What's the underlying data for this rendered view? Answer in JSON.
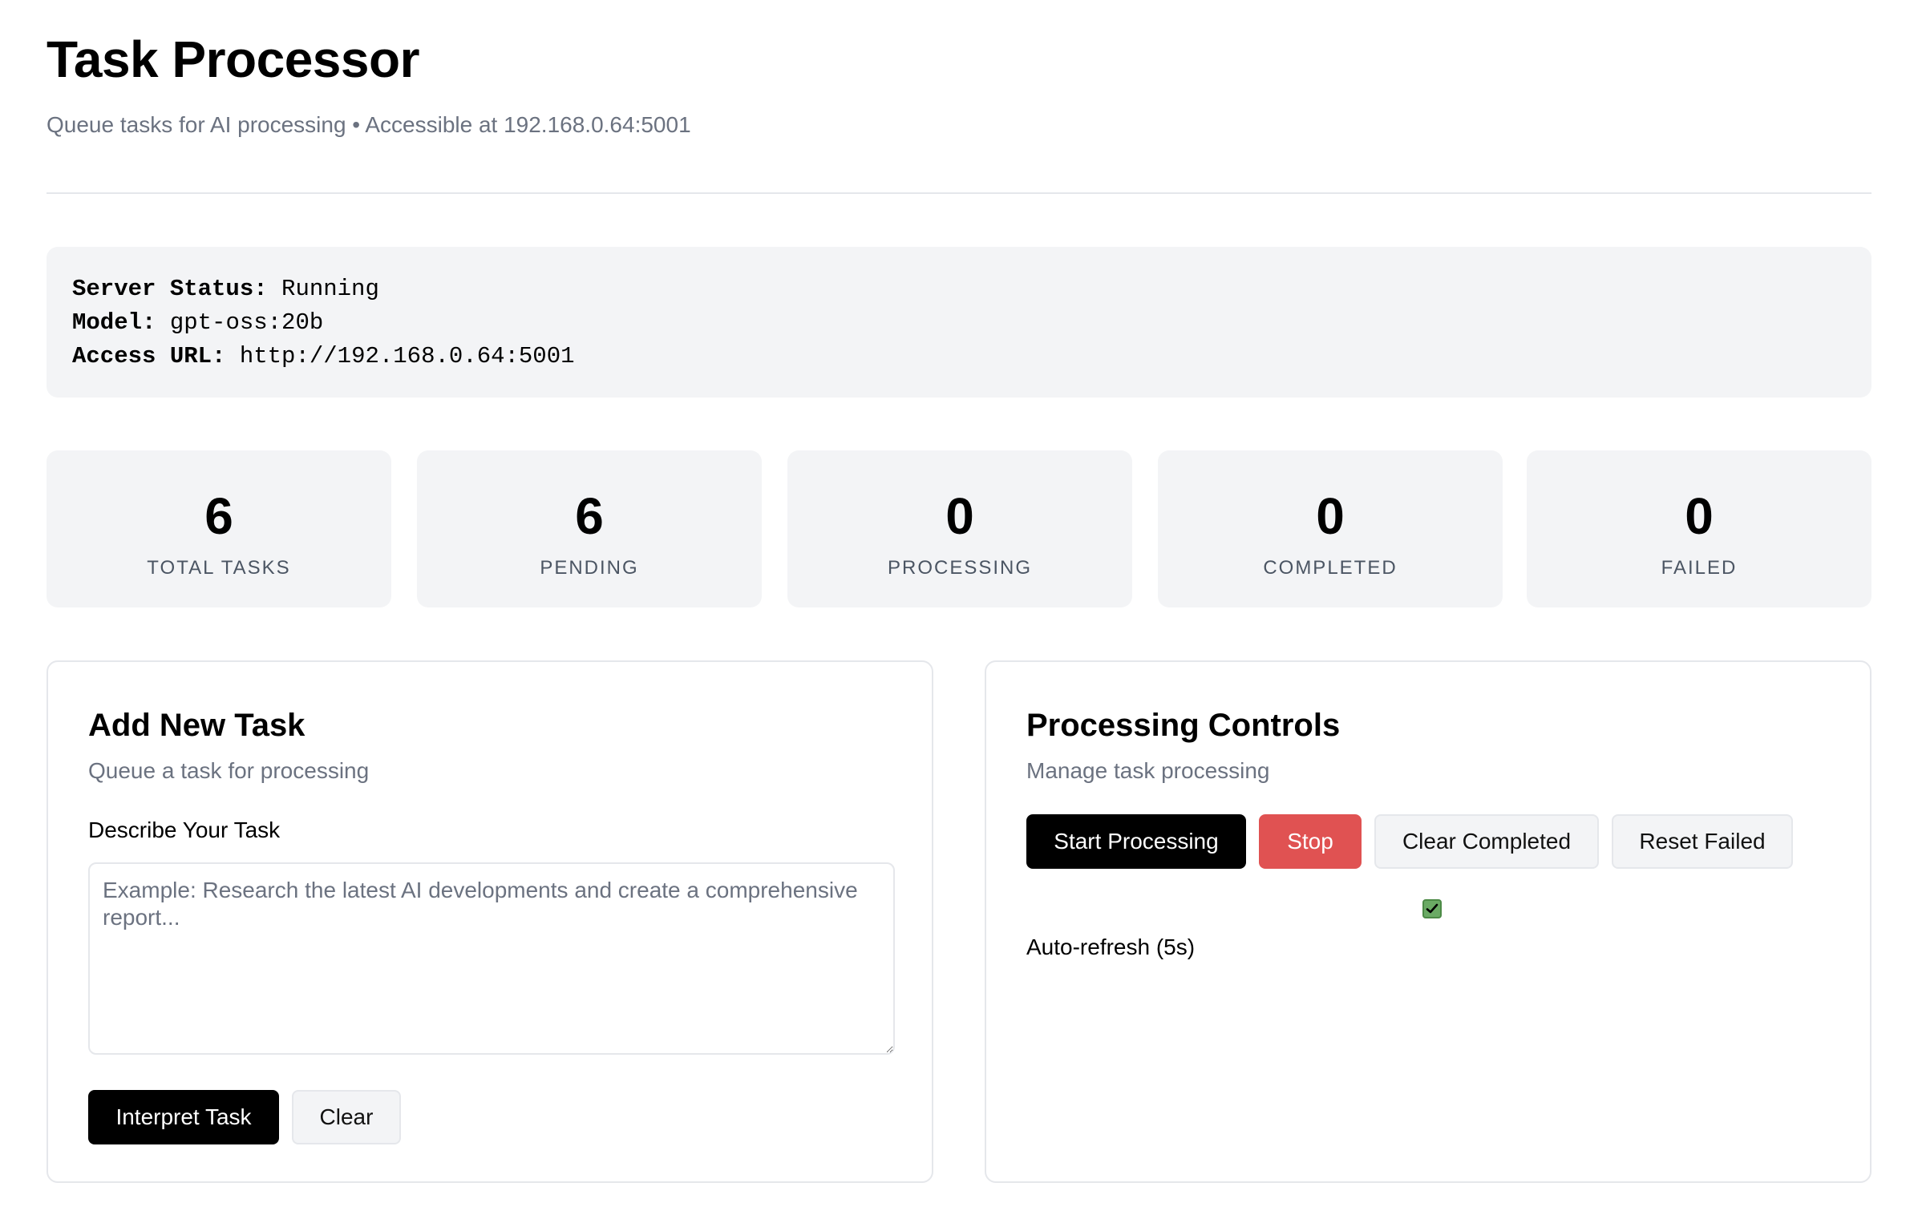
{
  "header": {
    "title": "Task Processor",
    "subtitle": "Queue tasks for AI processing • Accessible at 192.168.0.64:5001"
  },
  "server": {
    "status_key": "Server Status:",
    "status_value": "Running",
    "model_key": "Model:",
    "model_value": "gpt-oss:20b",
    "url_key": "Access URL:",
    "url_value": "http://192.168.0.64:5001"
  },
  "stats": [
    {
      "value": "6",
      "label": "TOTAL TASKS"
    },
    {
      "value": "6",
      "label": "PENDING"
    },
    {
      "value": "0",
      "label": "PROCESSING"
    },
    {
      "value": "0",
      "label": "COMPLETED"
    },
    {
      "value": "0",
      "label": "FAILED"
    }
  ],
  "add_task": {
    "title": "Add New Task",
    "subtitle": "Queue a task for processing",
    "field_label": "Describe Your Task",
    "textarea_value": "",
    "textarea_placeholder": "Example: Research the latest AI developments and create a comprehensive report...",
    "interpret_label": "Interpret Task",
    "clear_label": "Clear"
  },
  "controls": {
    "title": "Processing Controls",
    "subtitle": "Manage task processing",
    "start_label": "Start Processing",
    "stop_label": "Stop",
    "clear_completed_label": "Clear Completed",
    "reset_failed_label": "Reset Failed",
    "auto_refresh_label": "Auto-refresh (5s)",
    "auto_refresh_checked": true
  },
  "colors": {
    "primary": "#000000",
    "danger": "#e05252",
    "panel_bg": "#f3f4f6",
    "muted_text": "#6b7280",
    "checkbox": "#6aaa64"
  }
}
